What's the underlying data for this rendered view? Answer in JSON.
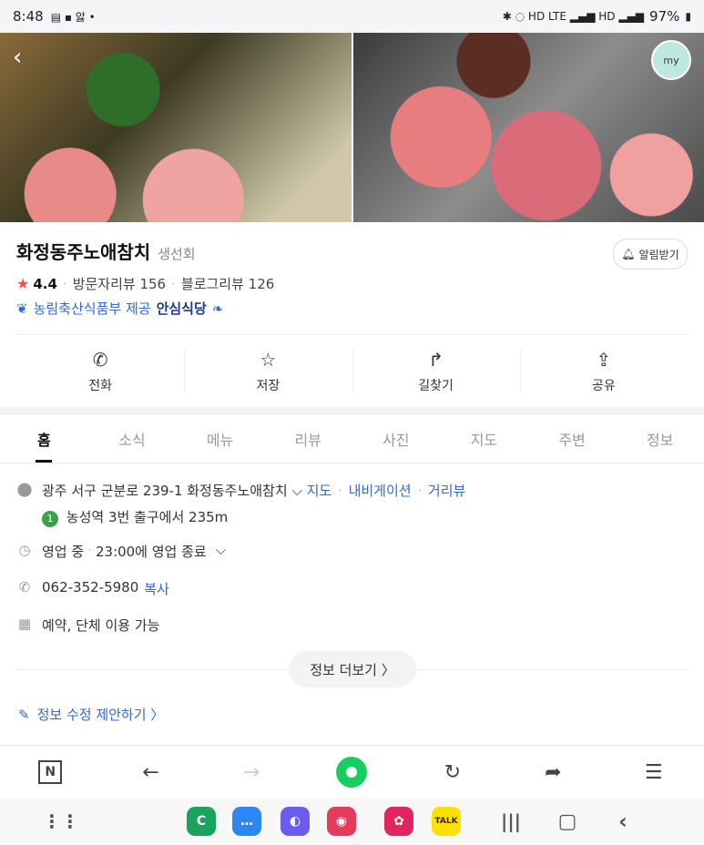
{
  "status": {
    "time": "8:48",
    "battery": "97%"
  },
  "place": {
    "name": "화정동주노애참치",
    "category": "생선회",
    "alarm_label": "알림받기",
    "rating": "4.4",
    "visitor_reviews": "방문자리뷰 156",
    "blog_reviews": "블로그리뷰 126",
    "badge_prefix": "농림축산식품부 제공",
    "badge_strong": "안심식당"
  },
  "actions": [
    {
      "label": "전화",
      "icon": "phone-icon"
    },
    {
      "label": "저장",
      "icon": "star-icon"
    },
    {
      "label": "길찾기",
      "icon": "directions-icon"
    },
    {
      "label": "공유",
      "icon": "share-icon"
    }
  ],
  "tabs": [
    "홈",
    "소식",
    "메뉴",
    "리뷰",
    "사진",
    "지도",
    "주변",
    "정보"
  ],
  "info": {
    "address": "광주 서구 군분로 239-1 화정동주노애참치",
    "map_link": "지도",
    "navi_link": "내비게이션",
    "street_link": "거리뷰",
    "subway_num": "1",
    "subway": "농성역 3번 출구에서 235m",
    "hours_status": "영업 중",
    "hours_detail": "23:00에 영업 종료",
    "phone": "062-352-5980",
    "copy": "복사",
    "options": "예약, 단체 이용 가능",
    "more": "정보 더보기 〉",
    "suggest": "정보 수정 제안하기 〉"
  },
  "avatar_label": "my",
  "colors": {
    "accent": "#2e6bd0",
    "green": "#19ce60",
    "star": "#f04e4e"
  }
}
